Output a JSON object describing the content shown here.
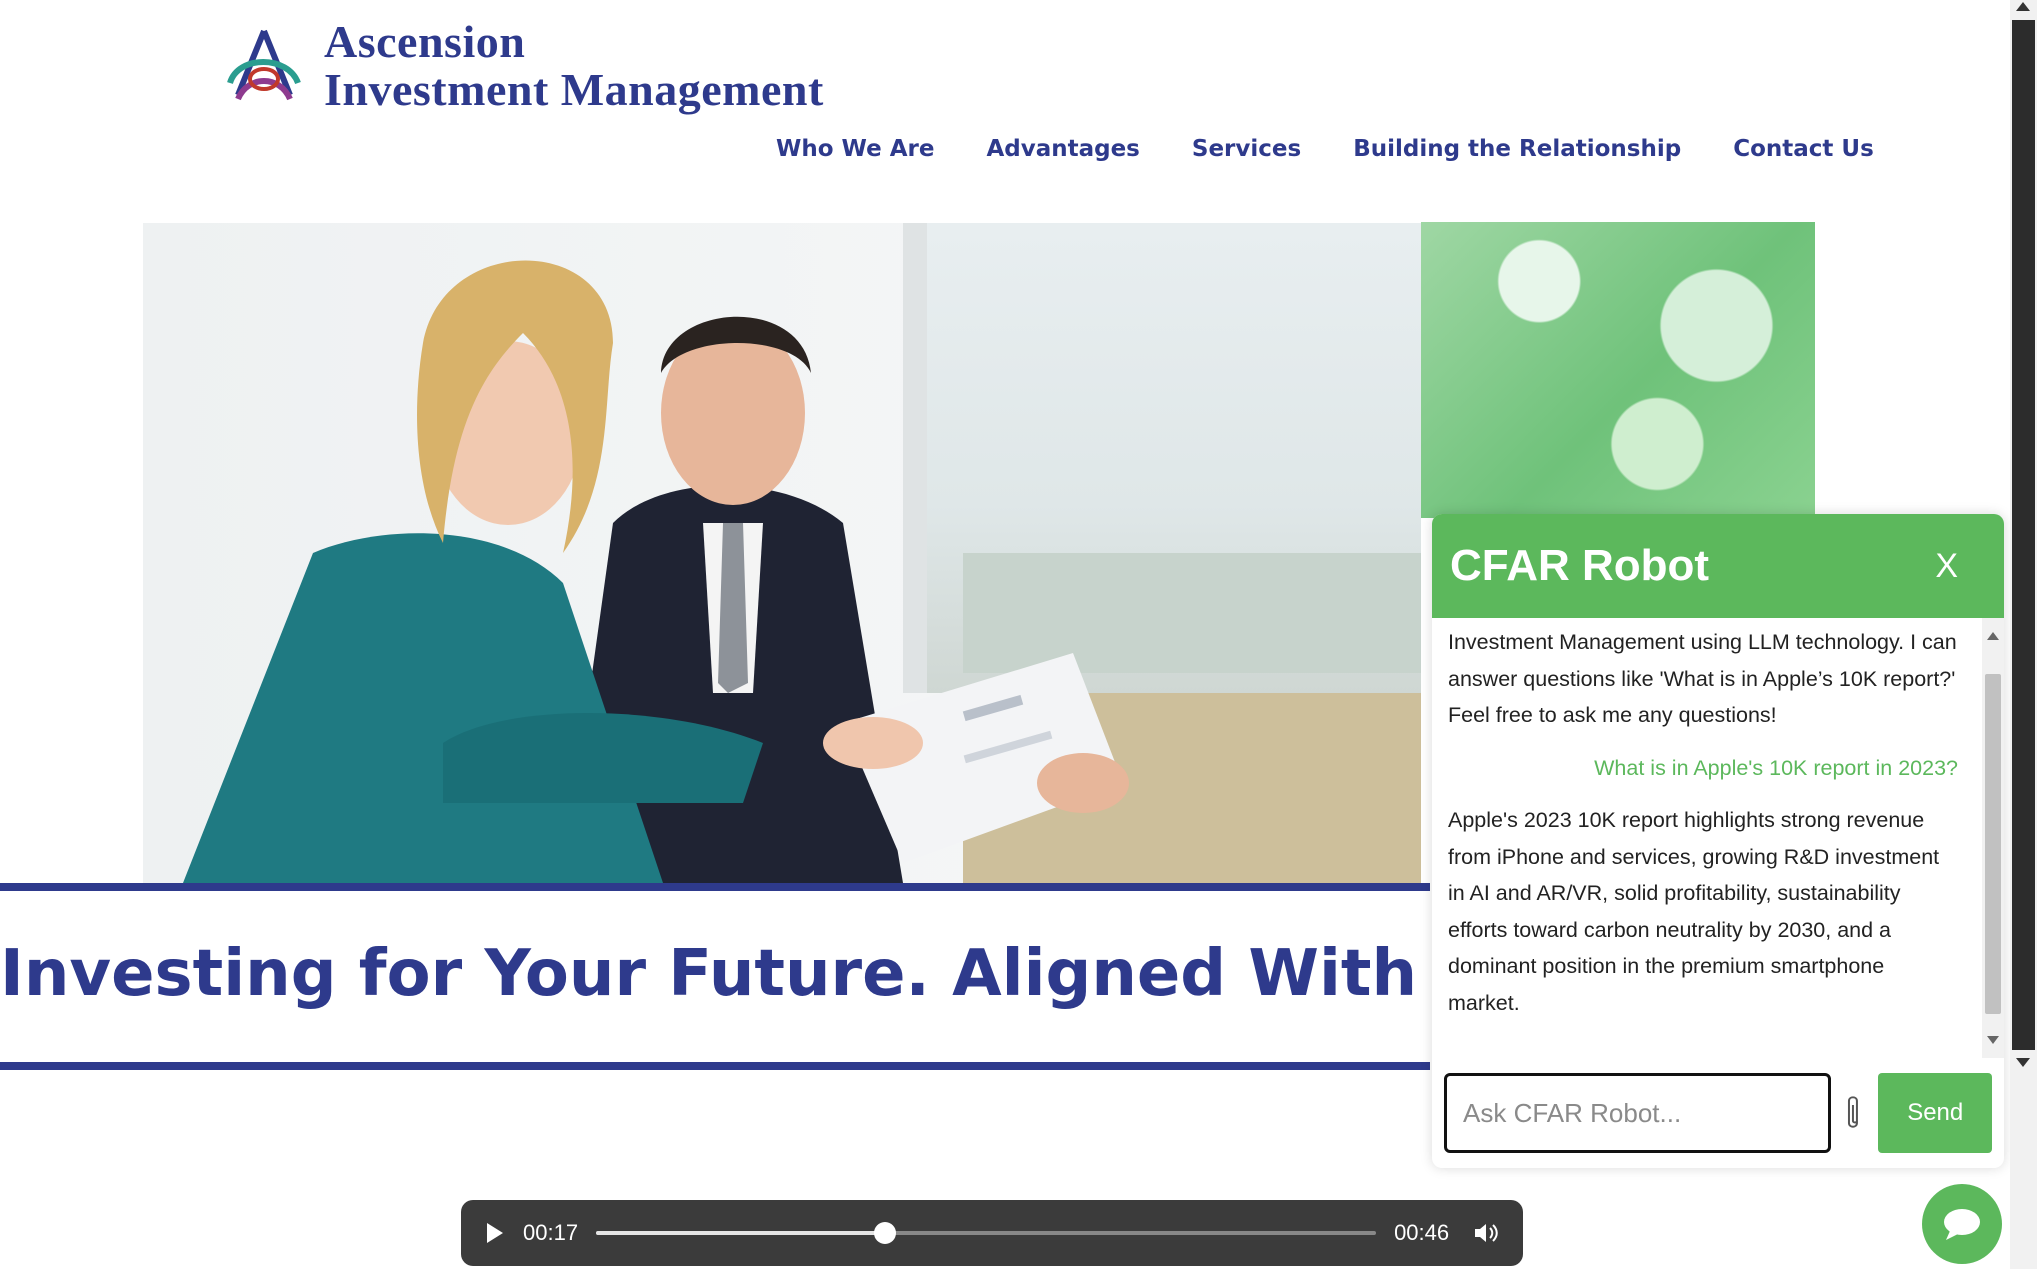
{
  "brand": {
    "line1": "Ascension",
    "line2": "Investment Management",
    "color": "#2e3a8c"
  },
  "nav": {
    "items": [
      {
        "label": "Who We Are"
      },
      {
        "label": "Advantages"
      },
      {
        "label": "Services"
      },
      {
        "label": "Building the Relationship"
      },
      {
        "label": "Contact Us"
      }
    ]
  },
  "hero": {
    "tagline": "Investing for Your Future. Aligned With Your Val"
  },
  "chat": {
    "title": "CFAR Robot",
    "close_label": "X",
    "messages": {
      "intro": "Investment Management using LLM technology. I can answer questions like 'What is in Apple’s 10K report?' Feel free to ask me any questions!",
      "user_question": "What is in Apple's 10K report in 2023?",
      "bot_answer": "Apple's 2023 10K report highlights strong revenue from iPhone and services, growing R&D investment in AI and AR/VR, solid profitability, sustainability efforts toward carbon neutrality by 2030, and a dominant position in the premium smartphone market."
    },
    "input_placeholder": "Ask CFAR Robot...",
    "send_label": "Send",
    "accent_color": "#5cb85c",
    "attach_icon": "paperclip-icon"
  },
  "audio": {
    "current_time": "00:17",
    "duration": "00:46",
    "progress": 0.37
  }
}
